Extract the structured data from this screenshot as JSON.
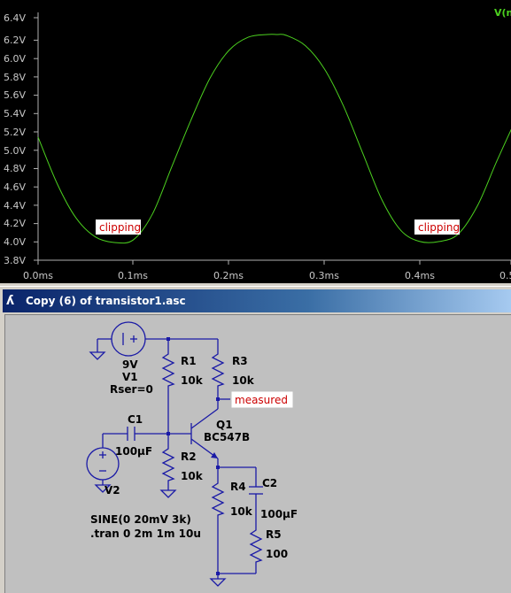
{
  "plot": {
    "trace_label": "V(n",
    "y_ticks": [
      "6.4V",
      "6.2V",
      "6.0V",
      "5.8V",
      "5.6V",
      "5.4V",
      "5.2V",
      "5.0V",
      "4.8V",
      "4.6V",
      "4.4V",
      "4.2V",
      "4.0V",
      "3.8V"
    ],
    "x_ticks": [
      "0.0ms",
      "0.1ms",
      "0.2ms",
      "0.3ms",
      "0.4ms",
      "0.5"
    ],
    "annotations": [
      "clipping",
      "clipping"
    ],
    "colors": {
      "background": "#000000",
      "trace": "#4cd11f",
      "axis": "#b0b0b0",
      "annotation_text": "#cc0000"
    }
  },
  "chart_data": {
    "type": "line",
    "title": "",
    "xlabel": "",
    "ylabel": "",
    "x_unit": "ms",
    "y_unit": "V",
    "xlim": [
      0.0,
      0.5
    ],
    "ylim": [
      3.8,
      6.4
    ],
    "grid": false,
    "series": [
      {
        "name": "V(n",
        "x": [
          0.0,
          0.02,
          0.04,
          0.06,
          0.08,
          0.1,
          0.12,
          0.14,
          0.16,
          0.18,
          0.2,
          0.22,
          0.24,
          0.25,
          0.26,
          0.28,
          0.3,
          0.32,
          0.34,
          0.36,
          0.38,
          0.4,
          0.42,
          0.44,
          0.46,
          0.48,
          0.5
        ],
        "y": [
          5.12,
          4.62,
          4.25,
          4.05,
          3.99,
          4.02,
          4.3,
          4.8,
          5.3,
          5.75,
          6.05,
          6.19,
          6.22,
          6.22,
          6.21,
          6.1,
          5.85,
          5.45,
          4.95,
          4.45,
          4.12,
          4.0,
          4.0,
          4.08,
          4.38,
          4.85,
          5.3
        ]
      }
    ]
  },
  "window": {
    "title": "Copy (6) of transistor1.asc"
  },
  "schematic": {
    "v1_value": "9V",
    "v1_name": "V1",
    "v1_param": "Rser=0",
    "r1": "R1",
    "r1_value": "10k",
    "r3": "R3",
    "r3_value": "10k",
    "c1": "C1",
    "c1_value": "100µF",
    "q1": "Q1",
    "q1_value": "BC547B",
    "r2": "R2",
    "r2_value": "10k",
    "v2": "V2",
    "r4": "R4",
    "r4_value": "10k",
    "c2": "C2",
    "c2_value": "100µF",
    "r5": "R5",
    "r5_value": "100",
    "sine": "SINE(0 20mV 3k)",
    "tran": ".tran 0 2m 1m 10u",
    "flag": "measured"
  }
}
